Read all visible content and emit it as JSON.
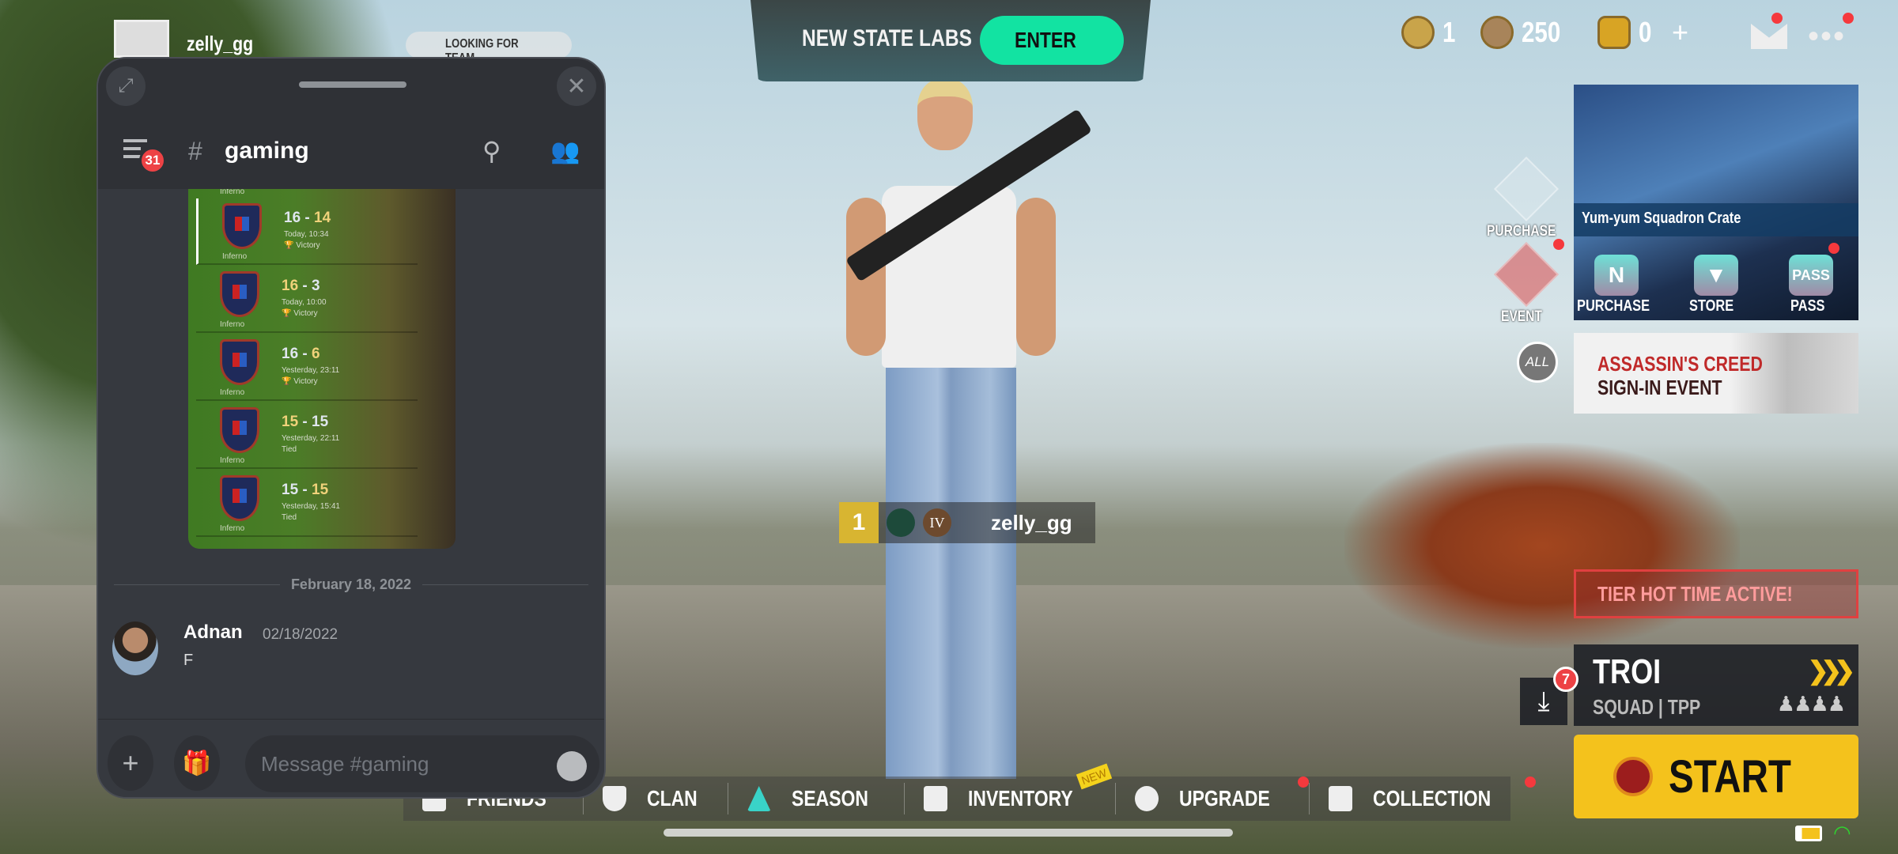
{
  "discord": {
    "channel": "gaming",
    "channel_prefix": "#",
    "unread_badge": "31",
    "attachment_matches": [
      {
        "map": "Inferno",
        "score_a": "16",
        "score_b": "14",
        "time": "Today, 10:34",
        "result": "Victory"
      },
      {
        "map": "Inferno",
        "score_a": "16",
        "score_b": "3",
        "time": "Today, 10:00",
        "result": "Victory"
      },
      {
        "map": "Inferno",
        "score_a": "16",
        "score_b": "6",
        "time": "Yesterday, 23:11",
        "result": "Victory"
      },
      {
        "map": "Inferno",
        "score_a": "15",
        "score_b": "15",
        "time": "Yesterday, 22:11",
        "result": "Tied"
      },
      {
        "map": "Inferno",
        "score_a": "15",
        "score_b": "15",
        "time": "Yesterday, 15:41",
        "result": "Tied"
      }
    ],
    "attachment_top_label": "Inferno",
    "date_divider": "February 18, 2022",
    "message": {
      "author": "Adnan",
      "timestamp": "02/18/2022",
      "text": "F"
    },
    "input_placeholder": "Message #gaming"
  },
  "game": {
    "player_name": "zelly_gg",
    "looking_for_team": "LOOKING FOR TEAM",
    "labs": {
      "title": "NEW STATE LABS",
      "enter": "ENTER",
      "accent": "#12e3a2"
    },
    "currencies": [
      {
        "icon": "medal-icon",
        "value": "1"
      },
      {
        "icon": "bp-coin-icon",
        "value": "250"
      },
      {
        "icon": "n-coin-icon",
        "value": "0"
      }
    ],
    "add_label": "+",
    "side_buttons": {
      "purchase": "PURCHASE",
      "event": "EVENT",
      "all": "ALL"
    },
    "crate": {
      "title": "Yum-yum Squadron Crate",
      "buttons": [
        "PURCHASE",
        "STORE",
        "PASS"
      ],
      "icon_labels": [
        "N",
        "▼",
        "PASS"
      ]
    },
    "banner": {
      "line1": "ASSASSIN'S CREED",
      "line2": "SIGN-IN EVENT"
    },
    "tier_hot_time": "TIER HOT TIME ACTIVE!",
    "mode": {
      "map": "TROI",
      "type": "SQUAD | TPP"
    },
    "download_badge": "7",
    "start": "START",
    "start_color": "#f4c21c",
    "player_tag": {
      "level": "1",
      "tier": "IV",
      "name": "zelly_gg"
    },
    "nav": [
      {
        "label": "FRIENDS",
        "icon": "friends-icon"
      },
      {
        "label": "CLAN",
        "icon": "shield-icon"
      },
      {
        "label": "SEASON",
        "icon": "season-icon"
      },
      {
        "label": "INVENTORY",
        "icon": "box-icon",
        "badge": "NEW"
      },
      {
        "label": "UPGRADE",
        "icon": "rank-icon"
      },
      {
        "label": "COLLECTION",
        "icon": "collection-icon"
      }
    ]
  }
}
